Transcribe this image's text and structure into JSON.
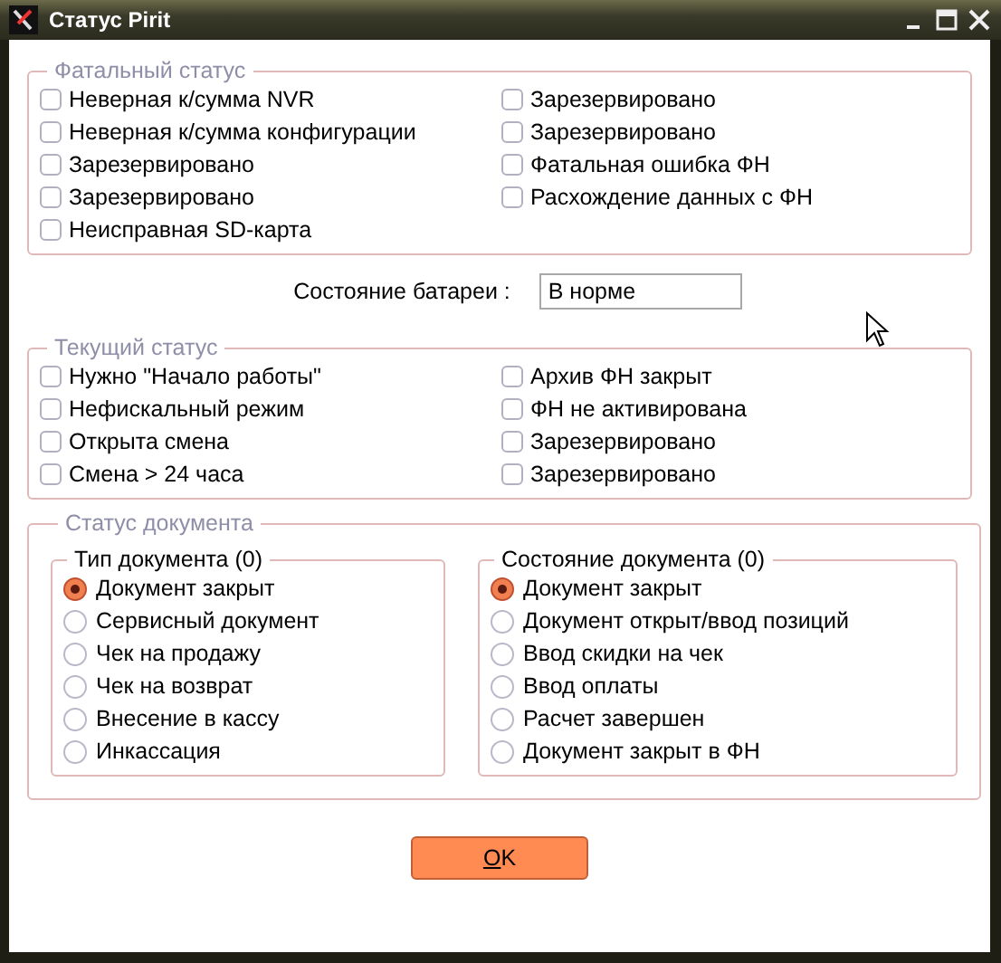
{
  "window": {
    "title": "Статус Pirit"
  },
  "fatal_status": {
    "title": "Фатальный статус",
    "items": [
      {
        "label": "Неверная к/сумма NVR",
        "checked": false
      },
      {
        "label": "Неверная к/сумма конфигурации",
        "checked": false
      },
      {
        "label": "Зарезервировано",
        "checked": false
      },
      {
        "label": "Зарезервировано",
        "checked": false
      },
      {
        "label": "Неисправная SD-карта",
        "checked": false
      },
      {
        "label": "Зарезервировано",
        "checked": false
      },
      {
        "label": "Зарезервировано",
        "checked": false
      },
      {
        "label": "Фатальная ошибка ФН",
        "checked": false
      },
      {
        "label": "Расхождение данных с ФН",
        "checked": false
      }
    ]
  },
  "battery": {
    "label": "Состояние батареи :",
    "value": "В норме"
  },
  "current_status": {
    "title": "Текущий статус",
    "items": [
      {
        "label": "Нужно \"Начало работы\"",
        "checked": false
      },
      {
        "label": "Нефискальный режим",
        "checked": false
      },
      {
        "label": "Открыта смена",
        "checked": false
      },
      {
        "label": "Смена > 24 часа",
        "checked": false
      },
      {
        "label": "Архив ФН закрыт",
        "checked": false
      },
      {
        "label": "ФН не активирована",
        "checked": false
      },
      {
        "label": "Зарезервировано",
        "checked": false
      },
      {
        "label": "Зарезервировано",
        "checked": false
      }
    ]
  },
  "document_status": {
    "title": "Статус документа",
    "groups": [
      {
        "title": "Тип документа (0)",
        "options": [
          {
            "label": "Документ закрыт",
            "selected": true
          },
          {
            "label": "Сервисный документ",
            "selected": false
          },
          {
            "label": "Чек на продажу",
            "selected": false
          },
          {
            "label": "Чек на возврат",
            "selected": false
          },
          {
            "label": "Внесение в кассу",
            "selected": false
          },
          {
            "label": "Инкассация",
            "selected": false
          }
        ]
      },
      {
        "title": "Состояние документа (0)",
        "options": [
          {
            "label": "Документ закрыт",
            "selected": true
          },
          {
            "label": "Документ открыт/ввод позиций",
            "selected": false
          },
          {
            "label": "Ввод скидки на чек",
            "selected": false
          },
          {
            "label": "Ввод оплаты",
            "selected": false
          },
          {
            "label": "Расчет завершен",
            "selected": false
          },
          {
            "label": "Документ закрыт в ФН",
            "selected": false
          }
        ]
      }
    ]
  },
  "buttons": [
    "OK"
  ]
}
